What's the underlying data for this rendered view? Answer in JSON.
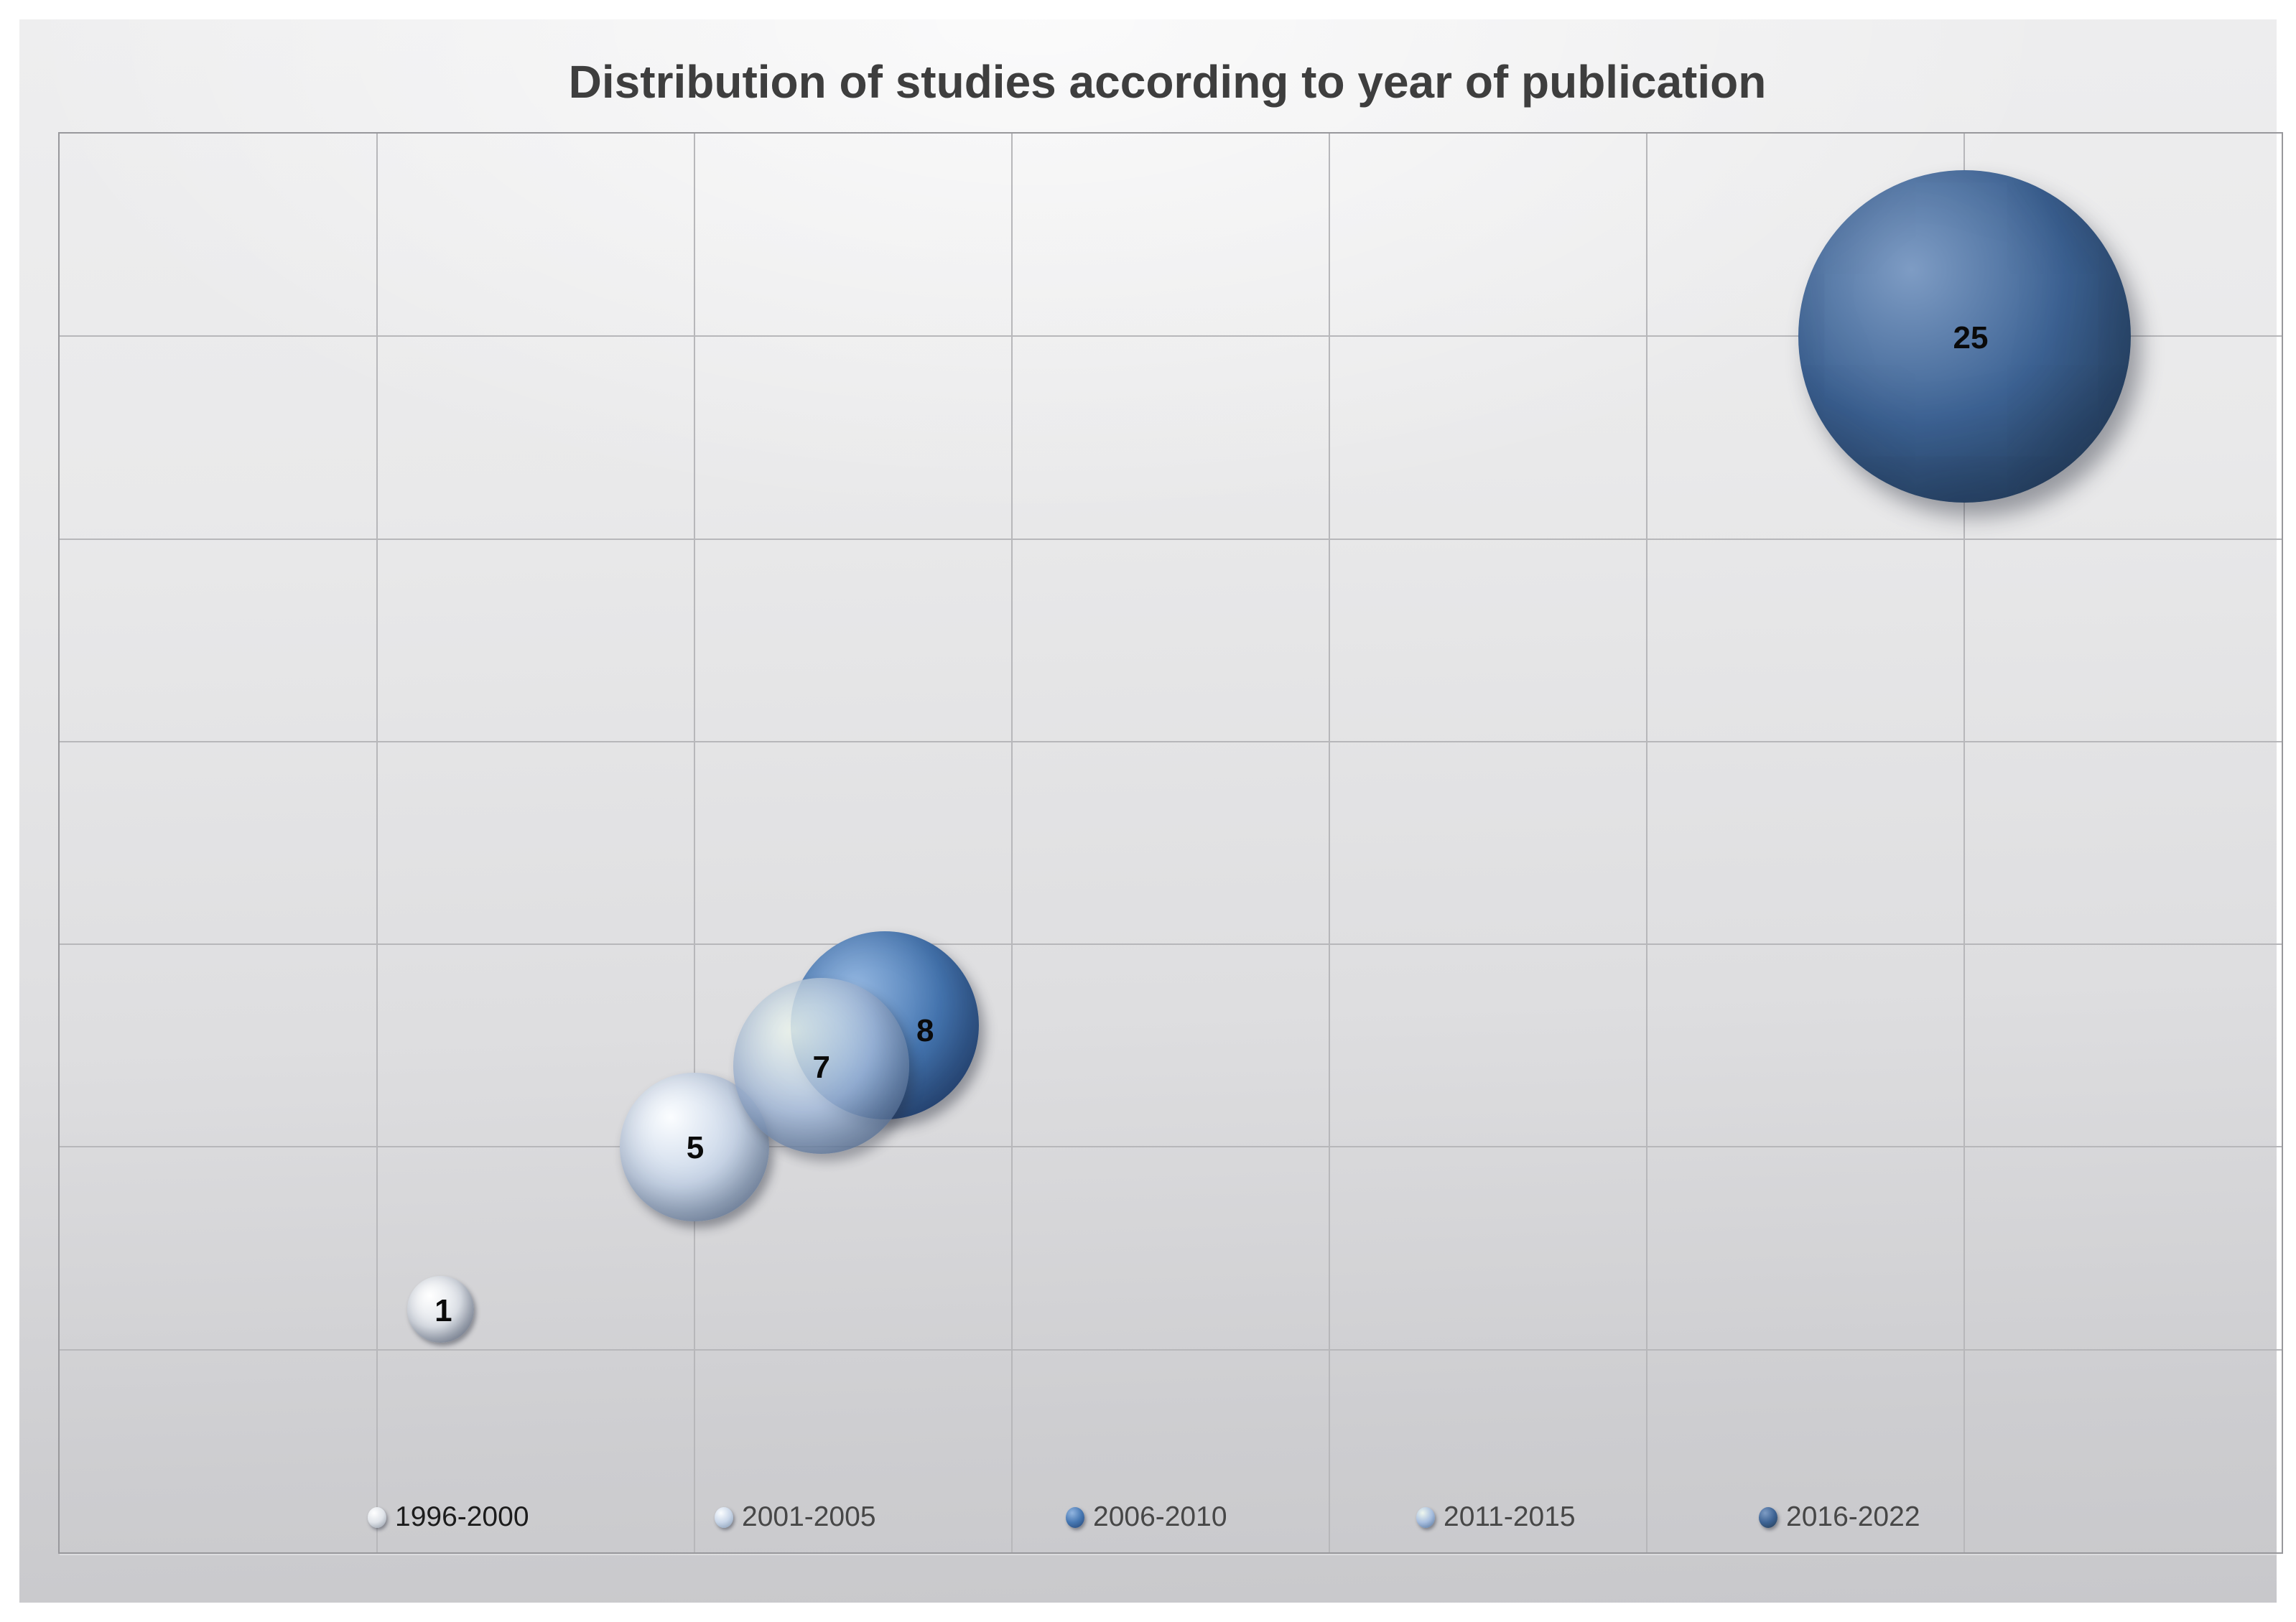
{
  "figure": {
    "background_color": "#ffffff",
    "panel_top_color": "#efefef",
    "panel_bottom_color": "#c8c8cb",
    "gridline_color": "#b7b7ba",
    "plot_border_color": "#98989c",
    "title_color": "#3e3e3e"
  },
  "chart_data": {
    "type": "bubble",
    "title": "Distribution of studies according to year of publication",
    "xlabel": "",
    "ylabel": "",
    "x_axis": {
      "min": -5,
      "max": 30,
      "gridline_step": 5,
      "tick_labels_visible": false
    },
    "y_axis": {
      "min": -5,
      "max": 30,
      "gridline_step": 5,
      "tick_labels_visible": false
    },
    "grid": "on",
    "legend_position": "bottom",
    "series": [
      {
        "name": "1996-2000",
        "x": 1,
        "y": 1,
        "size": 1,
        "data_label": "1",
        "color": "#dfe3e9",
        "highlight": "#ffffff",
        "edge": "#9aa2ae",
        "opacity": 1,
        "label_offset": [
          4,
          3
        ]
      },
      {
        "name": "2001-2005",
        "x": 5,
        "y": 5,
        "size": 5,
        "data_label": "5",
        "color": "#c9d6e8",
        "highlight": "#fbfdff",
        "edge": "#8da1ba",
        "opacity": 1,
        "label_offset": [
          1,
          2
        ]
      },
      {
        "name": "2006-2010",
        "x": 8,
        "y": 8,
        "size": 8,
        "data_label": "8",
        "color": "#4677b2",
        "highlight": "#93b6e0",
        "edge": "#2a4d7f",
        "opacity": 1,
        "label_offset": [
          56,
          8
        ]
      },
      {
        "name": "2011-2015",
        "x": 7,
        "y": 7,
        "size": 7,
        "data_label": "7",
        "color": "#a7bedf",
        "highlight": "#eff7ee",
        "edge": "#5f7da4",
        "opacity": 0.82,
        "label_offset": [
          0,
          2
        ]
      },
      {
        "name": "2016-2022",
        "x": 25,
        "y": 25,
        "size": 25,
        "data_label": "25",
        "color": "#3d6394",
        "highlight": "#7e9cc4",
        "edge": "#27425f",
        "opacity": 1,
        "label_offset": [
          9,
          3
        ]
      }
    ]
  },
  "legend": {
    "items": [
      {
        "label": "1996-2000",
        "text_color": "#1c1c1c"
      },
      {
        "label": "2001-2005",
        "text_color": "#474747"
      },
      {
        "label": "2006-2010",
        "text_color": "#474747"
      },
      {
        "label": "2011-2015",
        "text_color": "#474747"
      },
      {
        "label": "2016-2022",
        "text_color": "#474747"
      }
    ]
  }
}
